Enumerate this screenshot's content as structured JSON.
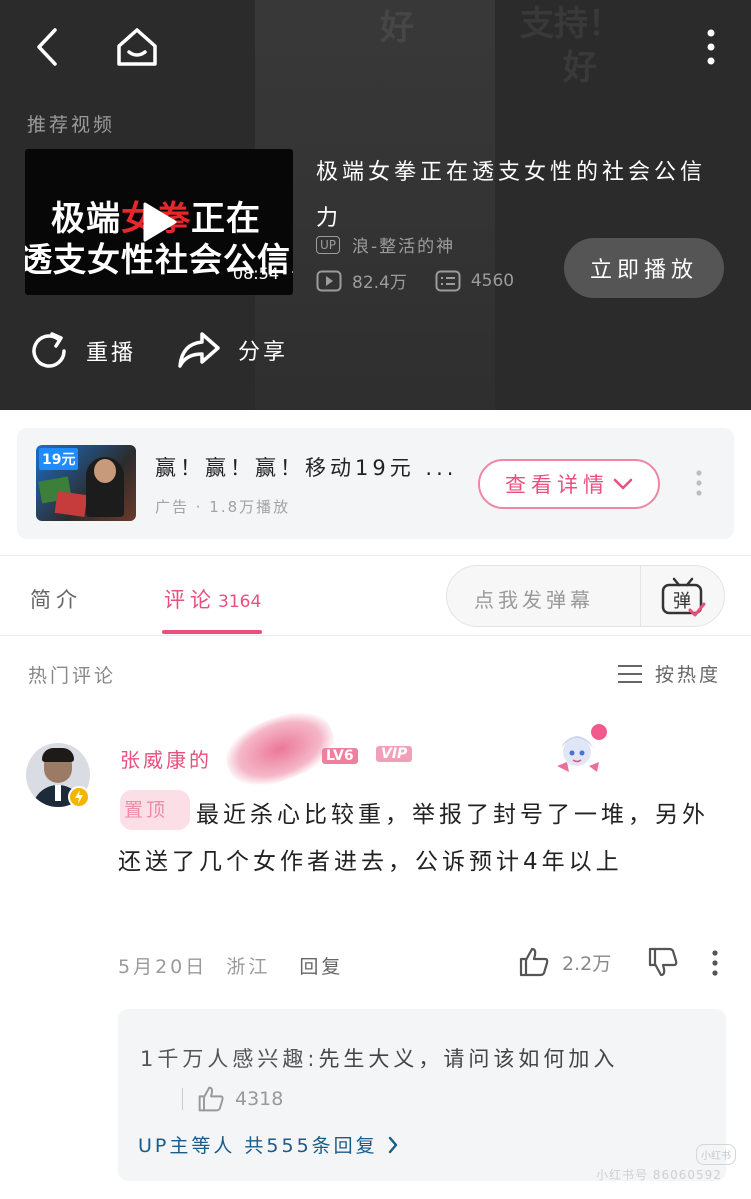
{
  "player": {
    "recommend_label": "推荐视频",
    "thumbnail": {
      "line1_prefix": "极端",
      "line1_red": "女拳",
      "line1_suffix": "正在",
      "line2": "透支女性社会公信力",
      "duration": "08:54"
    },
    "video_title": "极端女拳正在透支女性的社会公信力",
    "up_badge": "UP",
    "up_name": "浪-整活的神",
    "views": "82.4万",
    "danmaku_count": "4560",
    "play_now": "立即播放",
    "replay": "重播",
    "share": "分享",
    "background_text_1": "好",
    "background_text_2": "支持！",
    "background_text_3": "好"
  },
  "ad": {
    "image_price": "19元",
    "title": "赢！赢！赢！移动19元 ...",
    "subtitle": "广告 · 1.8万播放",
    "button": "查看详情"
  },
  "tabs": {
    "intro": "简介",
    "comments": "评论",
    "comments_count": "3164",
    "danmaku_placeholder": "点我发弹幕",
    "danmaku_icon_text": "弹"
  },
  "comments": {
    "section_title": "热门评论",
    "sort_label": "按热度",
    "items": [
      {
        "username": "张威康的",
        "level": "LV6",
        "vip": "VIP",
        "pinned": "置顶",
        "text": "最近杀心比较重，举报了封号了一堆，另外还送了几个女作者进去，公诉预计4年以上",
        "date": "5月20日",
        "location": "浙江",
        "reply_label": "回复",
        "likes": "2.2万",
        "replies": {
          "top_reply_user": "1千万人感兴趣:",
          "top_reply_text": "先生大义，请问该如何加入",
          "top_reply_likes": "4318",
          "more": "UP主等人 共555条回复"
        }
      }
    ]
  },
  "watermark": "小红书号 86060592",
  "watermark_logo": "小红书",
  "colors": {
    "accent": "#e8507e",
    "player_bg": "#2b2b2b",
    "link": "#1a5b8a"
  }
}
